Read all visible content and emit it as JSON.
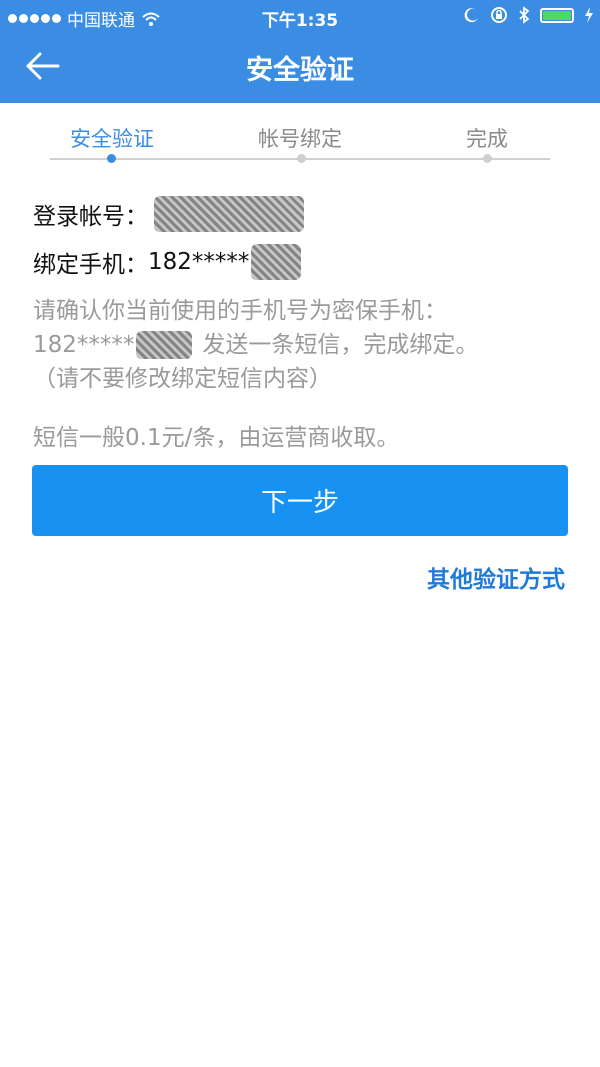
{
  "status": {
    "carrier": "中国联通",
    "time": "下午1:35"
  },
  "nav": {
    "title": "安全验证"
  },
  "steps": [
    {
      "label": "安全验证"
    },
    {
      "label": "帐号绑定"
    },
    {
      "label": "完成"
    }
  ],
  "account": {
    "label": "登录帐号："
  },
  "phone": {
    "label": "绑定手机：",
    "value": "182*****"
  },
  "description": {
    "line1": "请确认你当前使用的手机号为密保手机：",
    "line2_prefix": "182*****",
    "line2_suffix": "发送一条短信，完成绑定。",
    "line3": "（请不要修改绑定短信内容）"
  },
  "fee_note": "短信一般0.1元/条，由运营商收取。",
  "buttons": {
    "next": "下一步",
    "other_methods": "其他验证方式"
  },
  "colors": {
    "header": "#3b8de3",
    "primary_button": "#1791f2",
    "link": "#1f7ad8",
    "battery": "#4cd964"
  }
}
